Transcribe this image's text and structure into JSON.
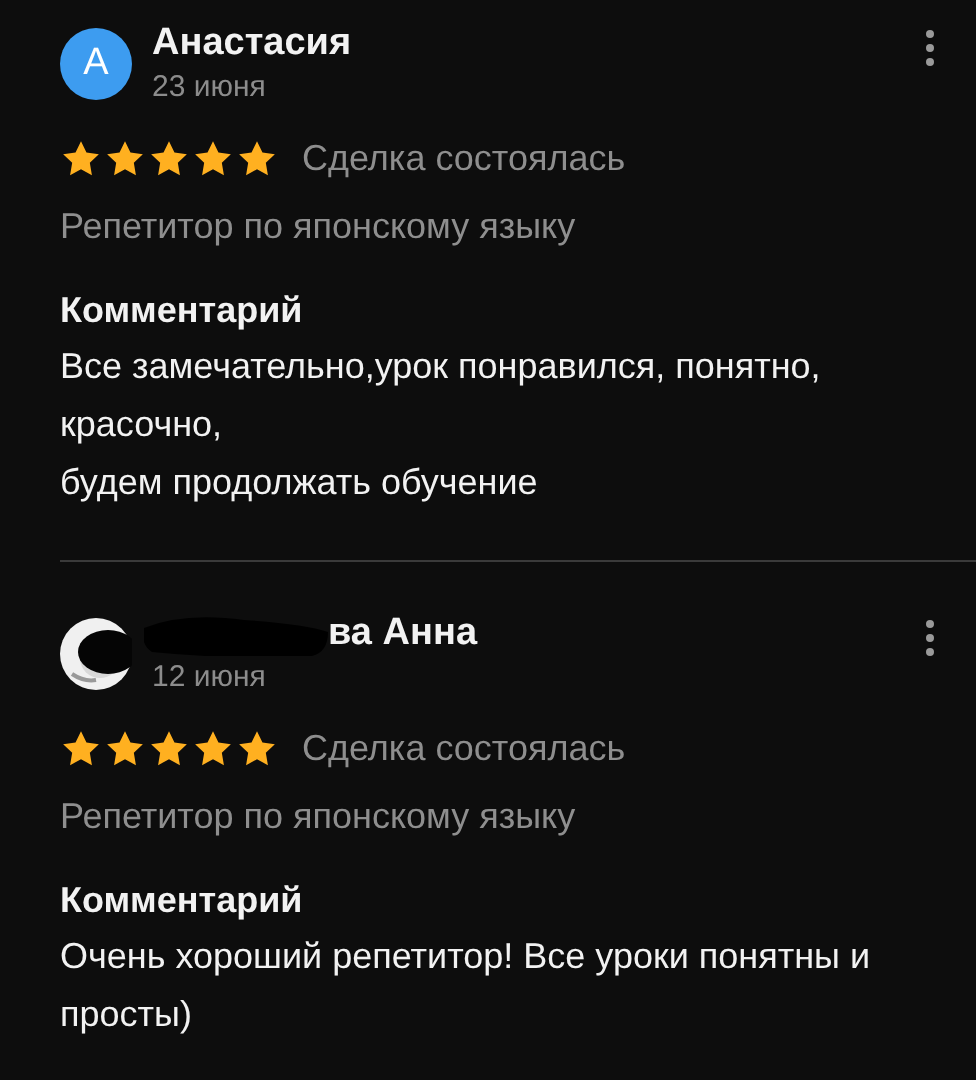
{
  "reviews": [
    {
      "avatar": {
        "kind": "letter",
        "letter": "А",
        "color": "#3d9cf0"
      },
      "name": "Анастасия",
      "name_redacted": false,
      "date": "23 июня",
      "stars": 5,
      "deal_status": "Сделка состоялась",
      "service": "Репетитор по японскому языку",
      "comment_heading": "Комментарий",
      "comment": "Все замечательно,урок понравился, понятно, красочно,\nбудем продолжать обучение"
    },
    {
      "name": "ва Анна",
      "name_redacted": true,
      "date": "12 июня",
      "stars": 5,
      "deal_status": "Сделка состоялась",
      "service": "Репетитор по японскому языку",
      "comment_heading": "Комментарий",
      "comment": "Очень хороший репетитор! Все уроки понятны и просты)"
    }
  ]
}
